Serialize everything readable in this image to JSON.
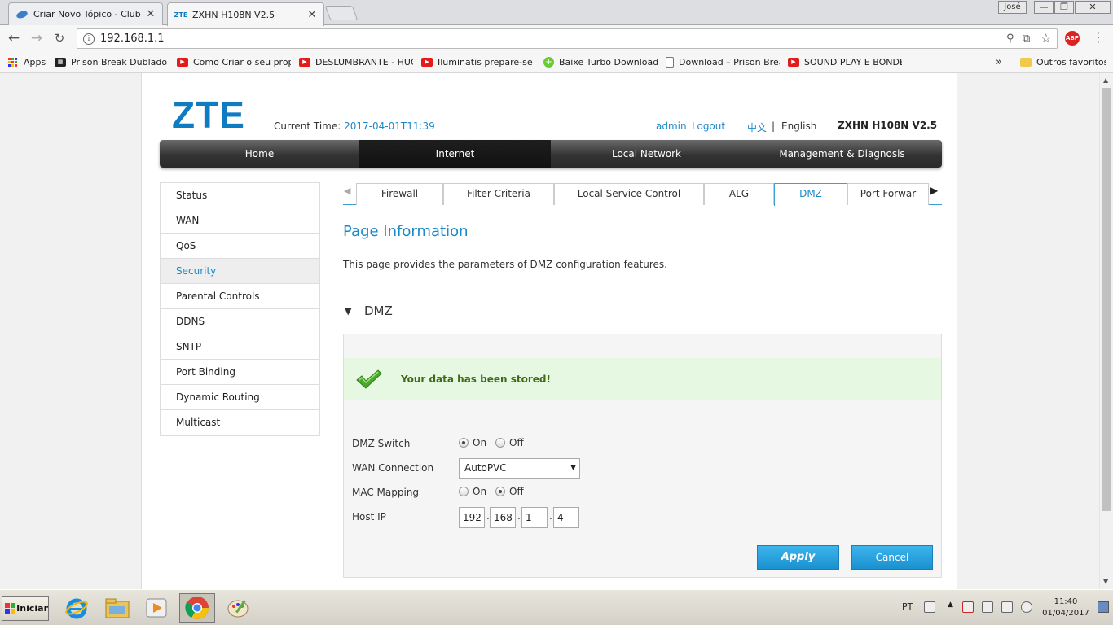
{
  "browser": {
    "tabs": [
      {
        "title": "Criar Novo Tópico - Clube d",
        "active": false
      },
      {
        "title": "ZXHN H108N V2.5",
        "active": true
      }
    ],
    "tab_close": "✕",
    "window_user": "José",
    "window_buttons": {
      "minimize": "—",
      "restore": "❐",
      "close": "✕"
    },
    "url": "192.168.1.1",
    "info_icon": "i",
    "abp_label": "ABP",
    "bookmarks": [
      {
        "label": "Apps",
        "icon": "apps-grid-icon"
      },
      {
        "label": "Prison Break Dublado – (",
        "icon": "film-icon"
      },
      {
        "label": "Como Criar o seu propric",
        "icon": "youtube-icon"
      },
      {
        "label": "DESLUMBRANTE - HUGO",
        "icon": "youtube-icon"
      },
      {
        "label": "Iluminatis prepare-se dv",
        "icon": "youtube-icon"
      },
      {
        "label": "Baixe Turbo Downloads",
        "icon": "plus-circle-icon"
      },
      {
        "label": "Download – Prison Break",
        "icon": "document-icon"
      },
      {
        "label": "SOUND PLAY E BONDE T",
        "icon": "youtube-icon"
      }
    ],
    "bookmarks_more": "»",
    "other_bookmarks": "Outros favoritos"
  },
  "router": {
    "logo": "ZTE",
    "current_time_label": "Current Time:",
    "current_time_value": "2017-04-01T11:39",
    "user": "admin",
    "logout": "Logout",
    "lang_cn": "中文",
    "lang_sep": "|",
    "lang_en": "English",
    "model": "ZXHN H108N V2.5",
    "main_nav": [
      {
        "label": "Home",
        "active": false
      },
      {
        "label": "Internet",
        "active": true
      },
      {
        "label": "Local Network",
        "active": false
      },
      {
        "label": "Management & Diagnosis",
        "active": false
      }
    ],
    "sidebar": [
      {
        "label": "Status",
        "active": false
      },
      {
        "label": "WAN",
        "active": false
      },
      {
        "label": "QoS",
        "active": false
      },
      {
        "label": "Security",
        "active": true
      },
      {
        "label": "Parental Controls",
        "active": false
      },
      {
        "label": "DDNS",
        "active": false
      },
      {
        "label": "SNTP",
        "active": false
      },
      {
        "label": "Port Binding",
        "active": false
      },
      {
        "label": "Dynamic Routing",
        "active": false
      },
      {
        "label": "Multicast",
        "active": false
      }
    ],
    "sub_tabs": [
      {
        "label": "Firewall",
        "active": false
      },
      {
        "label": "Filter Criteria",
        "active": false
      },
      {
        "label": "Local Service Control",
        "active": false
      },
      {
        "label": "ALG",
        "active": false
      },
      {
        "label": "DMZ",
        "active": true
      },
      {
        "label": "Port Forwar",
        "active": false
      }
    ],
    "page_info_title": "Page Information",
    "page_info_desc": "This page provides the parameters of DMZ configuration features.",
    "dmz_section_title": "DMZ",
    "success_message": "Your data has been stored!",
    "dmz_switch_label": "DMZ Switch",
    "dmz_switch_value": "On",
    "radio_on": "On",
    "radio_off": "Off",
    "wan_connection_label": "WAN Connection",
    "wan_connection_value": "AutoPVC",
    "mac_mapping_label": "MAC Mapping",
    "mac_mapping_value": "Off",
    "host_ip_label": "Host IP",
    "host_ip": [
      "192",
      "168",
      "1",
      "4"
    ],
    "apply_label": "Apply",
    "cancel_label": "Cancel",
    "accent_color": "#1a8ac7"
  },
  "taskbar": {
    "start_label": "Iniciar",
    "language": "PT",
    "time": "11:40",
    "date": "01/04/2017"
  }
}
